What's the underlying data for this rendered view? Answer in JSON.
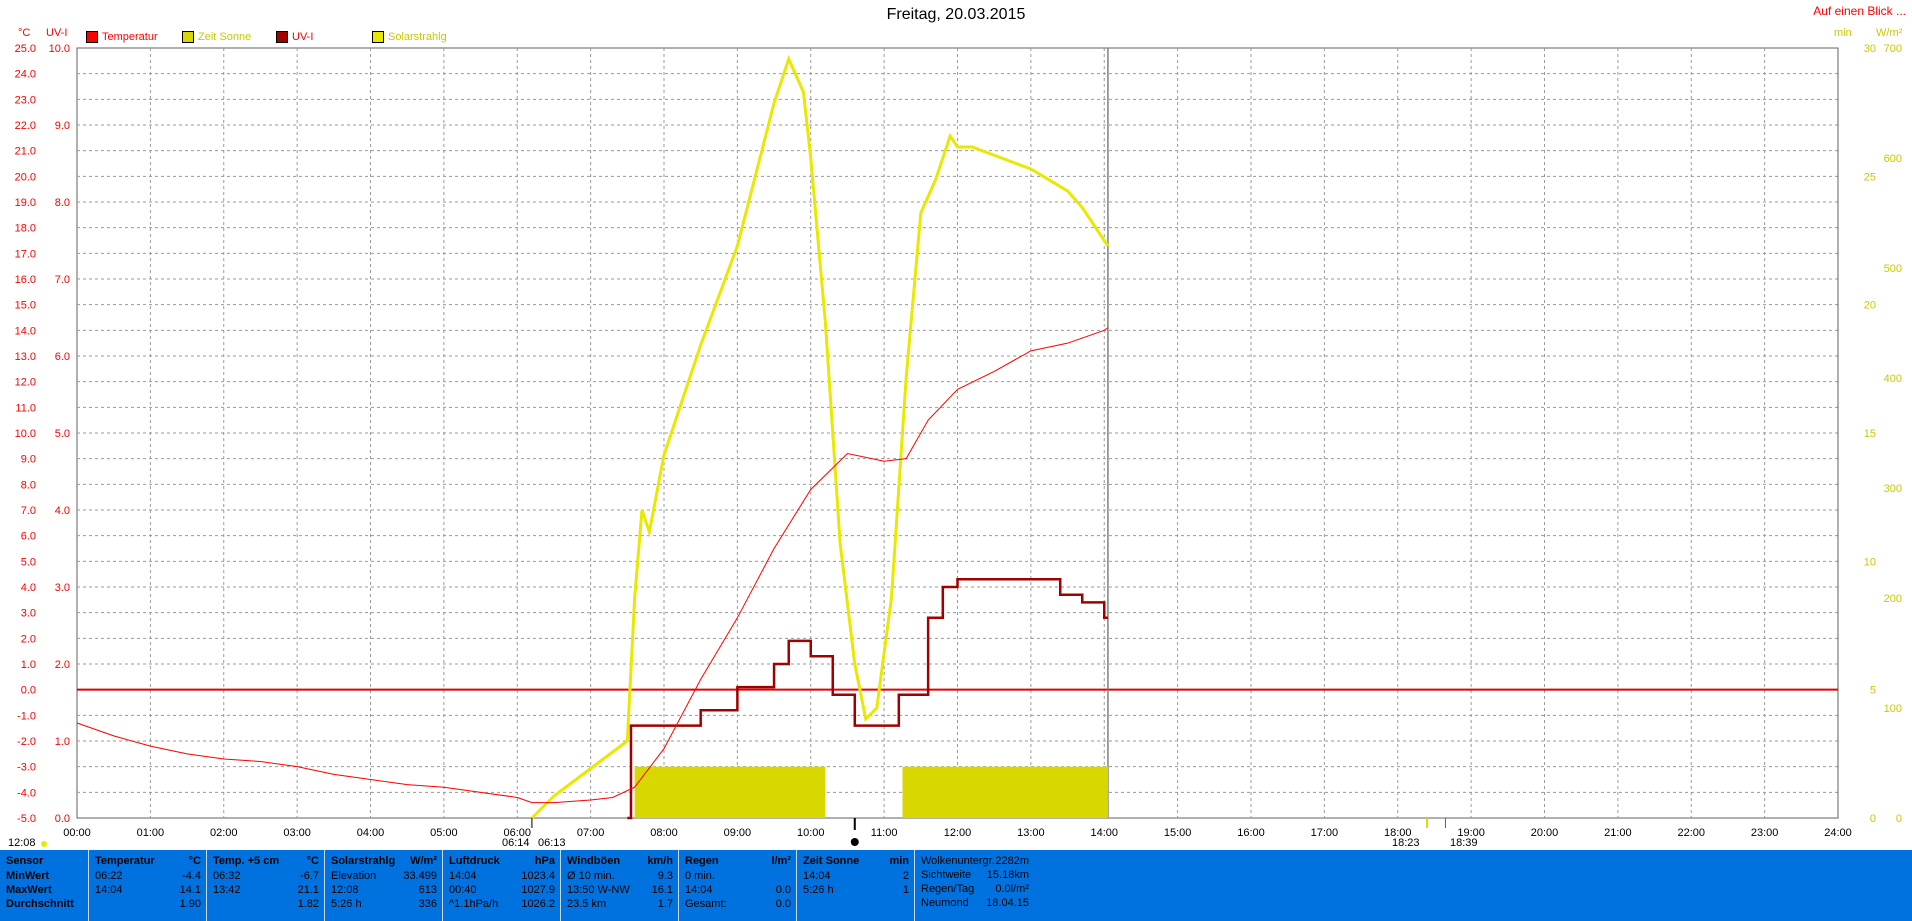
{
  "title": "Freitag, 20.03.2015",
  "top_right_link": "Auf einen Blick ...",
  "axis_labels": {
    "left_temp_unit": "°C",
    "left_uv_unit": "UV-I",
    "right_min_unit": "min",
    "right_wm2_unit": "W/m²"
  },
  "legend": [
    {
      "label": "Temperatur",
      "color": "#ff0000"
    },
    {
      "label": "Zeit Sonne",
      "color": "#d8d800"
    },
    {
      "label": "UV-I",
      "color": "#a00000"
    },
    {
      "label": "Solarstrahlg",
      "color": "#e8e800"
    }
  ],
  "markers": {
    "left_time": "12:08",
    "sunrise": "06:14",
    "sunrise2": "06:13",
    "sunset": "18:23",
    "sunset2": "18:39"
  },
  "chart_data": {
    "type": "line",
    "x_range": [
      "00:00",
      "24:00"
    ],
    "x_ticks": [
      "00:00",
      "01:00",
      "02:00",
      "03:00",
      "04:00",
      "05:00",
      "06:00",
      "07:00",
      "08:00",
      "09:00",
      "10:00",
      "11:00",
      "12:00",
      "13:00",
      "14:00",
      "15:00",
      "16:00",
      "17:00",
      "18:00",
      "19:00",
      "20:00",
      "21:00",
      "22:00",
      "23:00",
      "24:00"
    ],
    "y_temp_ticks": [
      "25.0",
      "24.0",
      "23.0",
      "22.0",
      "21.0",
      "20.0",
      "19.0",
      "18.0",
      "17.0",
      "16.0",
      "15.0",
      "14.0",
      "13.0",
      "12.0",
      "11.0",
      "10.0",
      "9.0",
      "8.0",
      "7.0",
      "6.0",
      "5.0",
      "4.0",
      "3.0",
      "2.0",
      "1.0",
      "0.0",
      "-1.0",
      "-2.0",
      "-3.0",
      "-4.0",
      "-5.0"
    ],
    "y_uv_ticks": [
      "10.0",
      "9.0",
      "8.0",
      "7.0",
      "6.0",
      "5.0",
      "4.0",
      "3.0",
      "2.0",
      "1.0",
      "0.0"
    ],
    "y_min_ticks": [
      "30",
      "25",
      "20",
      "15",
      "10",
      "5",
      "0"
    ],
    "y_wm2_ticks": [
      "700",
      "600",
      "500",
      "400",
      "300",
      "200",
      "100",
      "0"
    ],
    "temp_range": [
      -5,
      25
    ],
    "uv_range": [
      0,
      10
    ],
    "solar_range": [
      0,
      700
    ],
    "min_range": [
      0,
      30
    ],
    "series": [
      {
        "name": "Temperatur",
        "color": "#ff0000",
        "x": [
          0,
          0.5,
          1,
          1.5,
          2,
          2.5,
          3,
          3.5,
          4,
          4.5,
          5,
          5.5,
          6,
          6.2,
          6.5,
          7,
          7.3,
          7.6,
          8,
          8.5,
          9,
          9.5,
          10,
          10.5,
          11,
          11.3,
          11.6,
          12,
          12.5,
          13,
          13.5,
          14,
          14.05
        ],
        "y": [
          -1.3,
          -1.8,
          -2.2,
          -2.5,
          -2.7,
          -2.8,
          -3.0,
          -3.3,
          -3.5,
          -3.7,
          -3.8,
          -4.0,
          -4.2,
          -4.4,
          -4.4,
          -4.3,
          -4.2,
          -3.8,
          -2.3,
          0.4,
          2.8,
          5.5,
          7.8,
          9.2,
          8.9,
          9.0,
          10.5,
          11.7,
          12.4,
          13.2,
          13.5,
          14.0,
          14.1
        ]
      },
      {
        "name": "Solarstrahlg",
        "color": "#e8e800",
        "x": [
          6.2,
          6.5,
          7,
          7.3,
          7.5,
          7.6,
          7.7,
          7.8,
          8,
          8.5,
          9,
          9.5,
          9.7,
          9.9,
          10,
          10.2,
          10.4,
          10.6,
          10.75,
          10.9,
          11.1,
          11.3,
          11.5,
          11.7,
          11.9,
          12,
          12.2,
          12.4,
          12.6,
          12.8,
          13,
          13.3,
          13.5,
          13.7,
          14,
          14.05
        ],
        "y": [
          0,
          20,
          45,
          60,
          70,
          200,
          280,
          260,
          330,
          430,
          520,
          650,
          690,
          660,
          600,
          450,
          250,
          140,
          90,
          100,
          200,
          400,
          550,
          580,
          620,
          610,
          610,
          605,
          600,
          595,
          590,
          578,
          570,
          555,
          525,
          520
        ]
      },
      {
        "name": "UV-I",
        "color": "#a00000",
        "x": [
          7.5,
          7.55,
          8,
          8.5,
          9,
          9.5,
          9.7,
          9.9,
          10,
          10.3,
          10.6,
          10.9,
          11.2,
          11.6,
          11.8,
          12,
          12.5,
          13,
          13.4,
          13.7,
          14,
          14.05
        ],
        "y": [
          0,
          1.2,
          1.2,
          1.4,
          1.7,
          2.0,
          2.3,
          2.3,
          2.1,
          1.6,
          1.2,
          1.2,
          1.6,
          2.6,
          3.0,
          3.1,
          3.1,
          3.1,
          2.9,
          2.8,
          2.6,
          2.6
        ]
      },
      {
        "name": "Zeit Sonne",
        "color": "#d8d800",
        "type": "bar",
        "blocks": [
          [
            7.6,
            10.2,
            2
          ],
          [
            11.25,
            14.05,
            2
          ]
        ]
      }
    ],
    "grid": true,
    "legend_position": "top-left"
  },
  "stats": {
    "columns": [
      {
        "header": "Sensor",
        "unit": "",
        "rows": [
          [
            "MinWert",
            ""
          ],
          [
            "MaxWert",
            ""
          ],
          [
            "Durchschnitt",
            ""
          ]
        ]
      },
      {
        "header": "Temperatur",
        "unit": "°C",
        "rows": [
          [
            "06:22",
            "-4.4"
          ],
          [
            "14:04",
            "14.1"
          ],
          [
            "",
            "1.90"
          ]
        ]
      },
      {
        "header": "Temp. +5 cm",
        "unit": "°C",
        "rows": [
          [
            "06:32",
            "-6.7"
          ],
          [
            "13:42",
            "21.1"
          ],
          [
            "",
            "1.82"
          ]
        ]
      },
      {
        "header": "Solarstrahlg",
        "unit": "W/m²",
        "rows": [
          [
            "Elevation",
            "33.499"
          ],
          [
            "12:08",
            "613"
          ],
          [
            "5:26 h",
            "336"
          ]
        ]
      },
      {
        "header": "Luftdruck",
        "unit": "hPa",
        "rows": [
          [
            "14:04",
            "1023.4"
          ],
          [
            "00:40",
            "1027.9"
          ],
          [
            "^1.1hPa/h",
            "1026.2"
          ]
        ]
      },
      {
        "header": "Windböen",
        "unit": "km/h",
        "rows": [
          [
            "Ø 10 min.",
            "9.3"
          ],
          [
            "13:50   W-NW",
            "16.1"
          ],
          [
            "23.5 km",
            "1.7"
          ]
        ]
      },
      {
        "header": "Regen",
        "unit": "l/m²",
        "rows": [
          [
            "0 min.",
            ""
          ],
          [
            "14:04",
            "0.0"
          ],
          [
            "Gesamt:",
            "0.0"
          ]
        ]
      },
      {
        "header": "Zeit Sonne",
        "unit": "min",
        "rows": [
          [
            "14:04",
            "2"
          ],
          [
            "5:26 h",
            "1"
          ],
          [
            "",
            ""
          ]
        ]
      },
      {
        "header": "",
        "unit": "",
        "rows": [
          [
            "Wolkenuntergr.",
            "2282m"
          ],
          [
            "Sichtweite",
            "15.18km"
          ],
          [
            "Regen/Tag",
            "0.0l/m²"
          ],
          [
            "Neumond",
            "18.04.15"
          ]
        ]
      }
    ]
  }
}
